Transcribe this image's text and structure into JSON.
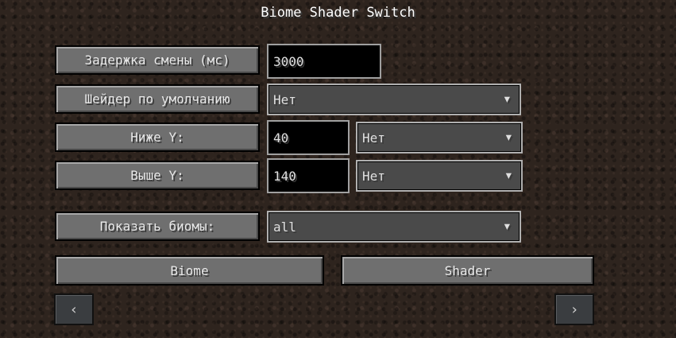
{
  "title": "Biome Shader Switch",
  "delay": {
    "label": "Задержка смены (мс)",
    "value": "3000"
  },
  "default_shader": {
    "label": "Шейдер по умолчанию",
    "value": "Нет",
    "arrow": "▼"
  },
  "below_y": {
    "label": "Ниже Y:",
    "value": "40",
    "shader": "Нет",
    "arrow": "▼"
  },
  "above_y": {
    "label": "Выше Y:",
    "value": "140",
    "shader": "Нет",
    "arrow": "▼"
  },
  "show_biomes": {
    "label": "Показать биомы:",
    "value": "all",
    "arrow": "▼"
  },
  "biome_button": "Biome",
  "shader_button": "Shader",
  "prev": "‹",
  "next": "›"
}
